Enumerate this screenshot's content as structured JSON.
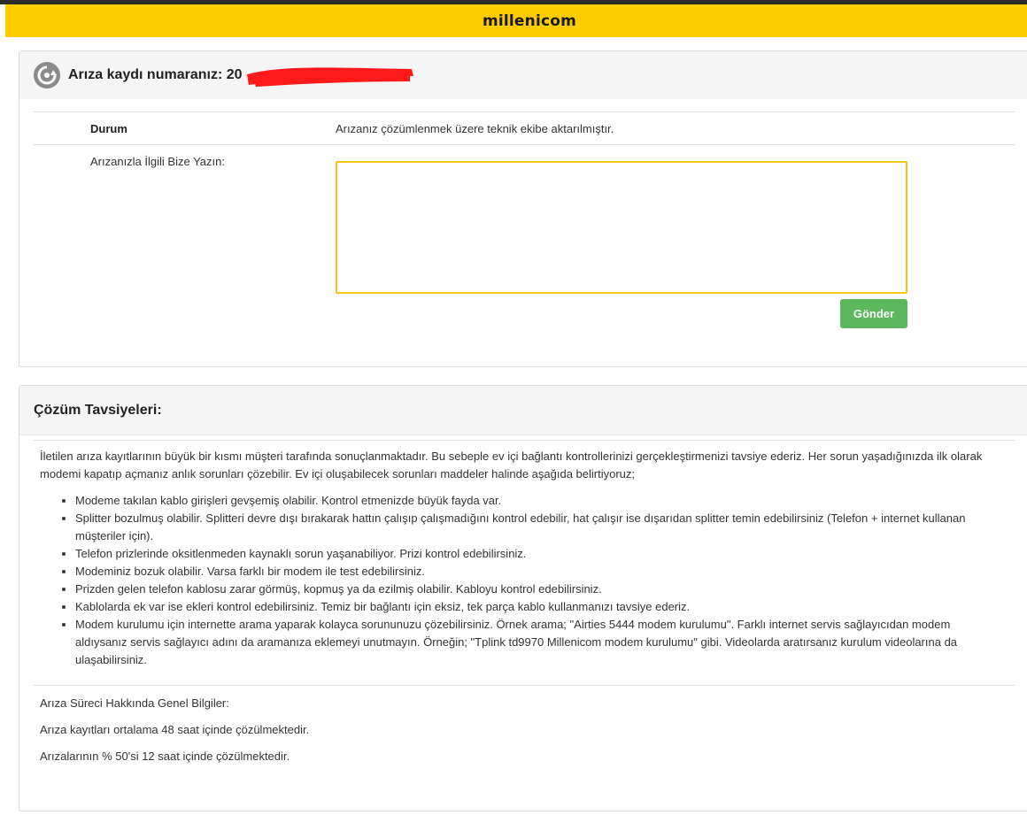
{
  "brand": {
    "name": "millenicom",
    "color": "#ffcc00"
  },
  "ticket": {
    "title": "Arıza kaydı numaranız: 20",
    "icon": "wrench-refresh-icon",
    "status_label": "Durum",
    "status_value": "Arızanız çözümlenmek üzere teknik ekibe aktarılmıştır.",
    "message_label": "Arızanızla İlgili Bize Yazın:",
    "message_value": "",
    "send_label": "Gönder",
    "send_color": "#5cb85c"
  },
  "solutions": {
    "title": "Çözüm Tavsiyeleri:",
    "intro": "İletilen arıza kayıtlarının büyük bir kısmı müşteri tarafında sonuçlanmaktadır. Bu sebeple ev içi bağlantı kontrollerinizi gerçekleştirmenizi tavsiye ederiz. Her sorun yaşadığınızda ilk olarak modemi kapatıp açmanız anlık sorunları çözebilir. Ev içi oluşabilecek sorunları maddeler halinde aşağıda belirtiyoruz;",
    "tips": [
      "Modeme takılan kablo girişleri gevşemiş olabilir. Kontrol etmenizde büyük fayda var.",
      "Splitter bozulmuş olabilir. Splitteri devre dışı bırakarak hattın çalışıp çalışmadığını kontrol edebilir, hat çalışır ise dışarıdan splitter temin edebilirsiniz (Telefon + internet kullanan müşteriler için).",
      "Telefon prizlerinde oksitlenmeden kaynaklı sorun yaşanabiliyor. Prizi kontrol edebilirsiniz.",
      "Modeminiz bozuk olabilir. Varsa farklı bir modem ile test edebilirsiniz.",
      "Prizden gelen telefon kablosu zarar görmüş, kopmuş ya da ezilmiş olabilir. Kabloyu kontrol edebilirsiniz.",
      "Kablolarda ek var ise ekleri kontrol edebilirsiniz. Temiz bir bağlantı için eksiz, tek parça kablo kullanmanızı tavsiye ederiz.",
      "Modem kurulumu için internette arama yaparak kolayca sorununuzu çözebilirsiniz. Örnek arama; \"Airties 5444 modem kurulumu\". Farklı internet servis sağlayıcıdan modem aldıysanız servis sağlayıcı adını da aramanıza eklemeyi unutmayın. Örneğin; \"Tplink td9970 Millenicom modem kurulumu\" gibi. Videolarda aratırsanız kurulum videolarına da ulaşabilirsiniz."
    ],
    "general_title": "Arıza Süreci Hakkında Genel Bilgiler:",
    "general_1": "Arıza kayıtları ortalama 48 saat içinde çözülmektedir.",
    "general_2": "Arızalarının % 50'si 12 saat içinde çözülmektedir."
  }
}
